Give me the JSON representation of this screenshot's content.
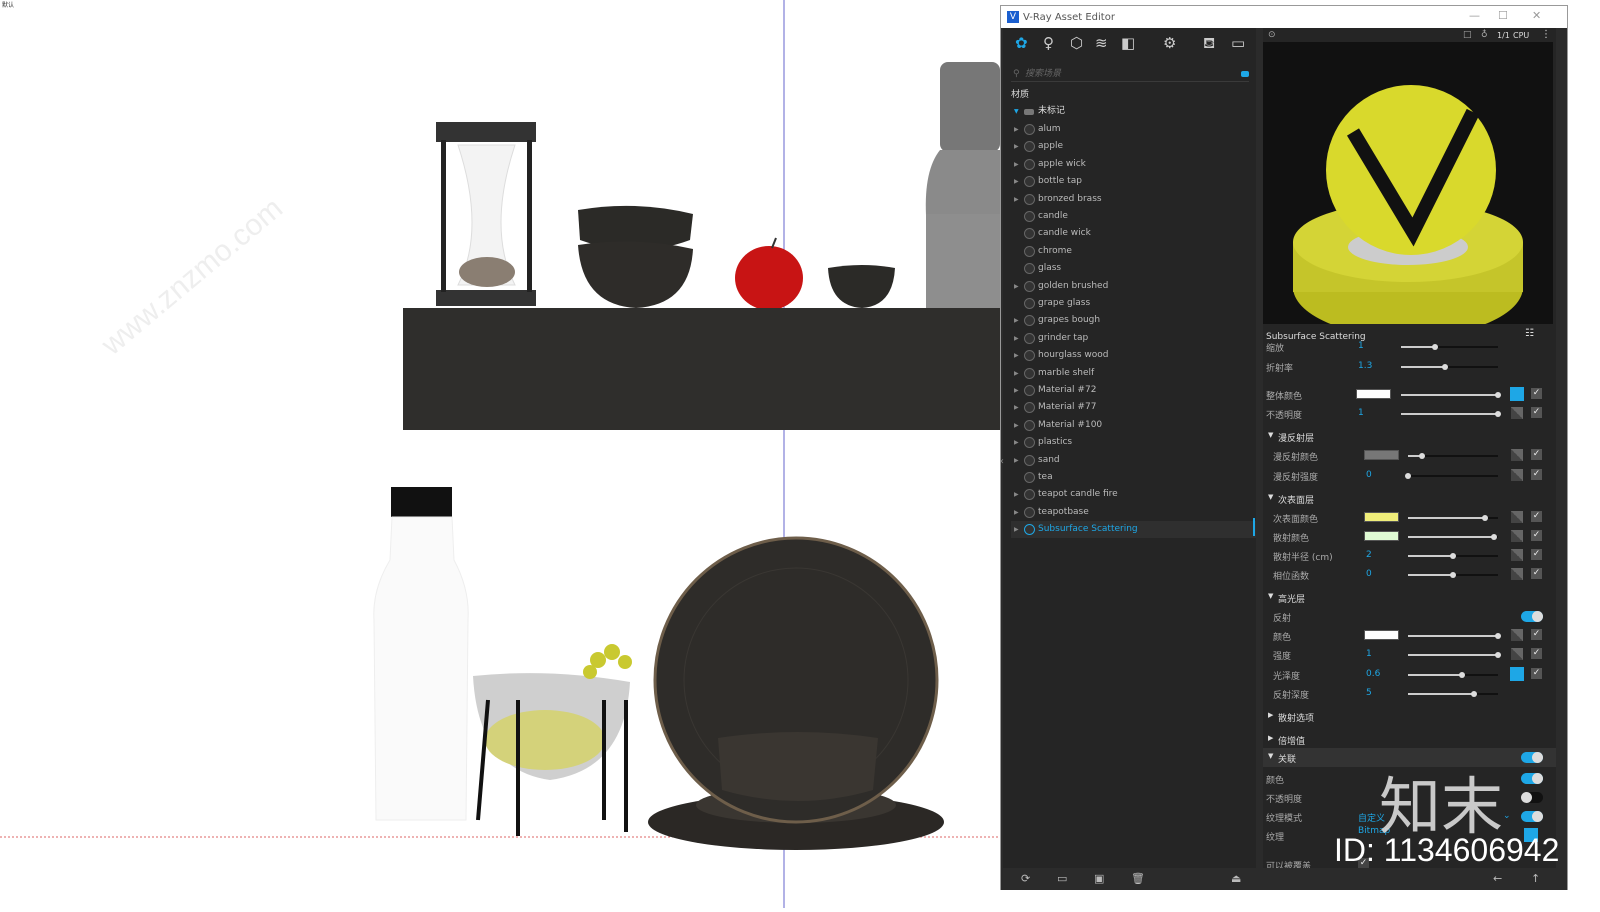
{
  "corner_label": "默认",
  "window": {
    "title": "V-Ray Asset Editor",
    "minimize": "—",
    "maximize": "☐",
    "close": "✕"
  },
  "toolbar": {
    "icons": [
      "materials-icon",
      "lights-icon",
      "geometry-icon",
      "layers-icon",
      "textures-icon",
      "settings-icon",
      "render-teapot-icon",
      "render-window-icon"
    ]
  },
  "search": {
    "placeholder": "搜索场景"
  },
  "materials": {
    "header": "材质",
    "group": "未标记",
    "selected": "Subsurface Scattering",
    "items": [
      {
        "name": "alum",
        "arrow": true
      },
      {
        "name": "apple",
        "arrow": true
      },
      {
        "name": "apple wick",
        "arrow": true
      },
      {
        "name": "bottle tap",
        "arrow": true
      },
      {
        "name": "bronzed brass",
        "arrow": true
      },
      {
        "name": "candle",
        "arrow": false
      },
      {
        "name": "candle wick",
        "arrow": false
      },
      {
        "name": "chrome",
        "arrow": false
      },
      {
        "name": "glass",
        "arrow": false
      },
      {
        "name": "golden brushed",
        "arrow": true
      },
      {
        "name": "grape glass",
        "arrow": false
      },
      {
        "name": "grapes bough",
        "arrow": true
      },
      {
        "name": "grinder tap",
        "arrow": true
      },
      {
        "name": "hourglass wood",
        "arrow": true
      },
      {
        "name": "marble shelf",
        "arrow": true
      },
      {
        "name": "Material #72",
        "arrow": true
      },
      {
        "name": "Material #77",
        "arrow": true
      },
      {
        "name": "Material #100",
        "arrow": true
      },
      {
        "name": "plastics",
        "arrow": true
      },
      {
        "name": "sand",
        "arrow": true
      },
      {
        "name": "tea",
        "arrow": false
      },
      {
        "name": "teapot candle fire",
        "arrow": true
      },
      {
        "name": "teapotbase",
        "arrow": true
      },
      {
        "name": "Subsurface Scattering",
        "arrow": true
      }
    ]
  },
  "preview": {
    "resolution": "1/1",
    "engine": "CPU"
  },
  "properties": {
    "title": "Subsurface Scattering",
    "rows": [
      {
        "kind": "val",
        "label": "缩放",
        "value": "1",
        "slider": 0.35
      },
      {
        "kind": "val",
        "label": "折射率",
        "value": "1.3",
        "slider": 0.45
      },
      {
        "kind": "color",
        "label": "整体颜色",
        "color": "#ffffff",
        "slider": 1,
        "map": true,
        "check": true,
        "map_on": true
      },
      {
        "kind": "val",
        "label": "不透明度",
        "value": "1",
        "slider": 1,
        "map": true,
        "check": true
      },
      {
        "kind": "section",
        "label": "漫反射层",
        "open": true
      },
      {
        "kind": "color",
        "label": "漫反射颜色",
        "color": "#777777",
        "slider": 0.15,
        "map": true,
        "check": true,
        "sub": true
      },
      {
        "kind": "val",
        "label": "漫反射强度",
        "value": "0",
        "slider": 0,
        "map": true,
        "check": true,
        "sub": true
      },
      {
        "kind": "section",
        "label": "次表面层",
        "open": true
      },
      {
        "kind": "color",
        "label": "次表面颜色",
        "color": "#f0ee7a",
        "slider": 0.85,
        "map": true,
        "check": true,
        "sub": true
      },
      {
        "kind": "color",
        "label": "散射颜色",
        "color": "#e0fbd4",
        "slider": 0.95,
        "map": true,
        "check": true,
        "sub": true
      },
      {
        "kind": "val",
        "label": "散射半径 (cm)",
        "value": "2",
        "slider": 0.5,
        "map": true,
        "check": true,
        "sub": true
      },
      {
        "kind": "val",
        "label": "相位函数",
        "value": "0",
        "slider": 0.5,
        "map": true,
        "check": true,
        "sub": true
      },
      {
        "kind": "section",
        "label": "高光层",
        "open": true
      },
      {
        "kind": "toggle",
        "label": "反射",
        "on": true,
        "sub": true
      },
      {
        "kind": "color",
        "label": "颜色",
        "color": "#ffffff",
        "slider": 1,
        "map": true,
        "check": true,
        "sub": true
      },
      {
        "kind": "val",
        "label": "强度",
        "value": "1",
        "slider": 1,
        "map": true,
        "check": true,
        "sub": true
      },
      {
        "kind": "val",
        "label": "光泽度",
        "value": "0.6",
        "slider": 0.6,
        "map": true,
        "check": true,
        "sub": true,
        "map_on": true
      },
      {
        "kind": "val",
        "label": "反射深度",
        "value": "5",
        "slider": 0.73,
        "sub": true
      },
      {
        "kind": "section",
        "label": "散射选项",
        "open": false
      },
      {
        "kind": "section",
        "label": "倍增值",
        "open": false
      },
      {
        "kind": "section",
        "label": "关联",
        "open": true,
        "toggle": true,
        "hl": true
      },
      {
        "kind": "toggle",
        "label": "颜色",
        "on": true
      },
      {
        "kind": "toggle",
        "label": "不透明度",
        "on": false
      },
      {
        "kind": "toggle",
        "label": "纹理模式",
        "on": true,
        "value": "自定义"
      },
      {
        "kind": "map",
        "label": "纹理",
        "value": "Bitmap"
      },
      {
        "kind": "check",
        "label": "可以被覆盖"
      }
    ]
  },
  "watermark": {
    "logo": "知末",
    "id": "ID: 1134606942",
    "site": "www.znzmo.com"
  },
  "colors": {
    "accent": "#1ea7e6",
    "panel": "#252525"
  }
}
